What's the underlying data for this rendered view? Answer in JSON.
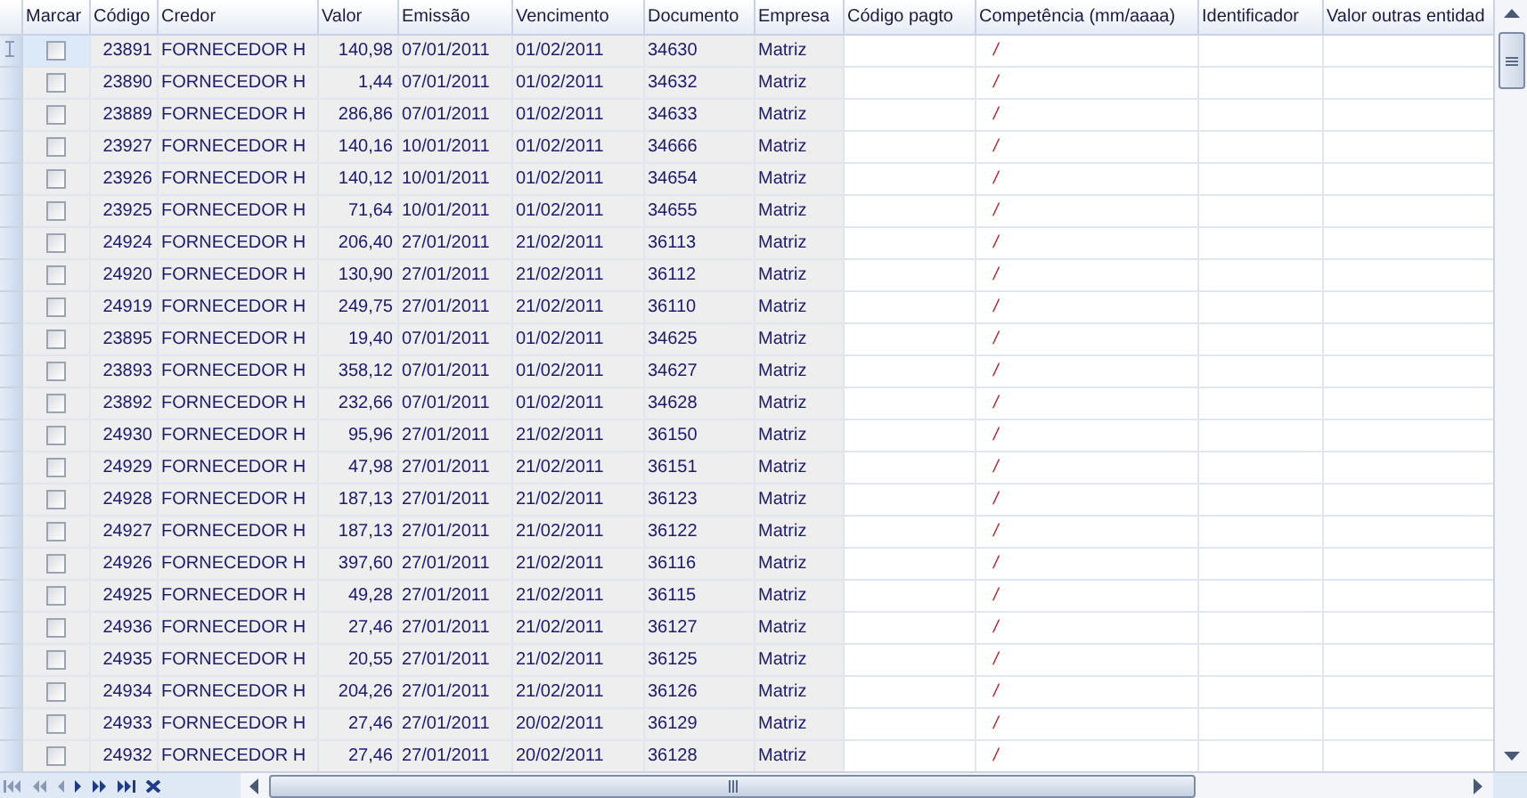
{
  "columns": [
    {
      "label": "Marcar",
      "kind": "check"
    },
    {
      "label": "Código",
      "kind": "number"
    },
    {
      "label": "Credor",
      "kind": "text"
    },
    {
      "label": "Valor",
      "kind": "number"
    },
    {
      "label": "Emissão",
      "kind": "text"
    },
    {
      "label": "Vencimento",
      "kind": "text"
    },
    {
      "label": "Documento",
      "kind": "text"
    },
    {
      "label": "Empresa",
      "kind": "text"
    },
    {
      "label": "Código pagto",
      "kind": "input"
    },
    {
      "label": "Competência (mm/aaaa)",
      "kind": "mask"
    },
    {
      "label": "Identificador",
      "kind": "input"
    },
    {
      "label": "Valor outras entidad",
      "kind": "input"
    }
  ],
  "rows": [
    {
      "selected": true,
      "checked": false,
      "values": [
        "23891",
        "FORNECEDOR H",
        "140,98",
        "07/01/2011",
        "01/02/2011",
        "34630",
        "Matriz",
        "/"
      ]
    },
    {
      "selected": false,
      "checked": false,
      "values": [
        "23890",
        "FORNECEDOR H",
        "1,44",
        "07/01/2011",
        "01/02/2011",
        "34632",
        "Matriz",
        "/"
      ]
    },
    {
      "selected": false,
      "checked": false,
      "values": [
        "23889",
        "FORNECEDOR H",
        "286,86",
        "07/01/2011",
        "01/02/2011",
        "34633",
        "Matriz",
        "/"
      ]
    },
    {
      "selected": false,
      "checked": false,
      "values": [
        "23927",
        "FORNECEDOR H",
        "140,16",
        "10/01/2011",
        "01/02/2011",
        "34666",
        "Matriz",
        "/"
      ]
    },
    {
      "selected": false,
      "checked": false,
      "values": [
        "23926",
        "FORNECEDOR H",
        "140,12",
        "10/01/2011",
        "01/02/2011",
        "34654",
        "Matriz",
        "/"
      ]
    },
    {
      "selected": false,
      "checked": false,
      "values": [
        "23925",
        "FORNECEDOR H",
        "71,64",
        "10/01/2011",
        "01/02/2011",
        "34655",
        "Matriz",
        "/"
      ]
    },
    {
      "selected": false,
      "checked": false,
      "values": [
        "24924",
        "FORNECEDOR H",
        "206,40",
        "27/01/2011",
        "21/02/2011",
        "36113",
        "Matriz",
        "/"
      ]
    },
    {
      "selected": false,
      "checked": false,
      "values": [
        "24920",
        "FORNECEDOR H",
        "130,90",
        "27/01/2011",
        "21/02/2011",
        "36112",
        "Matriz",
        "/"
      ]
    },
    {
      "selected": false,
      "checked": false,
      "values": [
        "24919",
        "FORNECEDOR H",
        "249,75",
        "27/01/2011",
        "21/02/2011",
        "36110",
        "Matriz",
        "/"
      ]
    },
    {
      "selected": false,
      "checked": false,
      "values": [
        "23895",
        "FORNECEDOR H",
        "19,40",
        "07/01/2011",
        "01/02/2011",
        "34625",
        "Matriz",
        "/"
      ]
    },
    {
      "selected": false,
      "checked": false,
      "values": [
        "23893",
        "FORNECEDOR H",
        "358,12",
        "07/01/2011",
        "01/02/2011",
        "34627",
        "Matriz",
        "/"
      ]
    },
    {
      "selected": false,
      "checked": false,
      "values": [
        "23892",
        "FORNECEDOR H",
        "232,66",
        "07/01/2011",
        "01/02/2011",
        "34628",
        "Matriz",
        "/"
      ]
    },
    {
      "selected": false,
      "checked": false,
      "values": [
        "24930",
        "FORNECEDOR H",
        "95,96",
        "27/01/2011",
        "21/02/2011",
        "36150",
        "Matriz",
        "/"
      ]
    },
    {
      "selected": false,
      "checked": false,
      "values": [
        "24929",
        "FORNECEDOR H",
        "47,98",
        "27/01/2011",
        "21/02/2011",
        "36151",
        "Matriz",
        "/"
      ]
    },
    {
      "selected": false,
      "checked": false,
      "values": [
        "24928",
        "FORNECEDOR H",
        "187,13",
        "27/01/2011",
        "21/02/2011",
        "36123",
        "Matriz",
        "/"
      ]
    },
    {
      "selected": false,
      "checked": false,
      "values": [
        "24927",
        "FORNECEDOR H",
        "187,13",
        "27/01/2011",
        "21/02/2011",
        "36122",
        "Matriz",
        "/"
      ]
    },
    {
      "selected": false,
      "checked": false,
      "values": [
        "24926",
        "FORNECEDOR H",
        "397,60",
        "27/01/2011",
        "21/02/2011",
        "36116",
        "Matriz",
        "/"
      ]
    },
    {
      "selected": false,
      "checked": false,
      "values": [
        "24925",
        "FORNECEDOR H",
        "49,28",
        "27/01/2011",
        "21/02/2011",
        "36115",
        "Matriz",
        "/"
      ]
    },
    {
      "selected": false,
      "checked": false,
      "values": [
        "24936",
        "FORNECEDOR H",
        "27,46",
        "27/01/2011",
        "21/02/2011",
        "36127",
        "Matriz",
        "/"
      ]
    },
    {
      "selected": false,
      "checked": false,
      "values": [
        "24935",
        "FORNECEDOR H",
        "20,55",
        "27/01/2011",
        "21/02/2011",
        "36125",
        "Matriz",
        "/"
      ]
    },
    {
      "selected": false,
      "checked": false,
      "values": [
        "24934",
        "FORNECEDOR H",
        "204,26",
        "27/01/2011",
        "21/02/2011",
        "36126",
        "Matriz",
        "/"
      ]
    },
    {
      "selected": false,
      "checked": false,
      "values": [
        "24933",
        "FORNECEDOR H",
        "27,46",
        "27/01/2011",
        "20/02/2011",
        "36129",
        "Matriz",
        "/"
      ]
    },
    {
      "selected": false,
      "checked": false,
      "values": [
        "24932",
        "FORNECEDOR H",
        "27,46",
        "27/01/2011",
        "20/02/2011",
        "36128",
        "Matriz",
        "/"
      ]
    }
  ]
}
